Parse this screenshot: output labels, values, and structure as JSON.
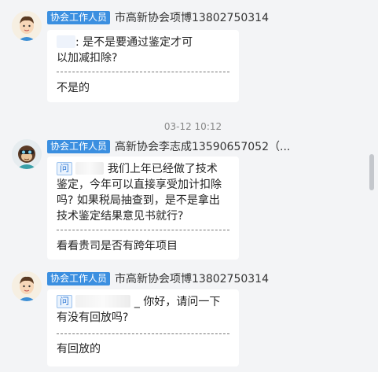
{
  "messages": [
    {
      "role": "协会工作人员",
      "sender": "市高新协会项博13802750314",
      "question_tag": "",
      "question_lines": [
        ": 是不是要通过鉴定才可",
        "以加减扣除?"
      ],
      "answer": "不是的"
    },
    {
      "role": "协会工作人员",
      "sender": "高新协会李志成13590657052（...",
      "question_tag": "问",
      "question_lines": [
        "我们上年已经做了技术",
        "鉴定，今年可以直接享受加计扣除",
        "吗? 如果税局抽查到，是不是拿出",
        "技术鉴定结果意见书就行?"
      ],
      "answer": "看看贵司是否有跨年项目"
    },
    {
      "role": "协会工作人员",
      "sender": "市高新协会项博13802750314",
      "question_tag": "问",
      "question_lines": [
        "_  你好，请问一下",
        "有没有回放吗?"
      ],
      "answer": "有回放的"
    }
  ],
  "timestamp": "03-12 10:12",
  "icons": {
    "avatar1": "cartoon-man-avatar-icon",
    "avatar2": "monkey-avatar-icon",
    "avatar3": "cartoon-man-avatar-icon"
  }
}
